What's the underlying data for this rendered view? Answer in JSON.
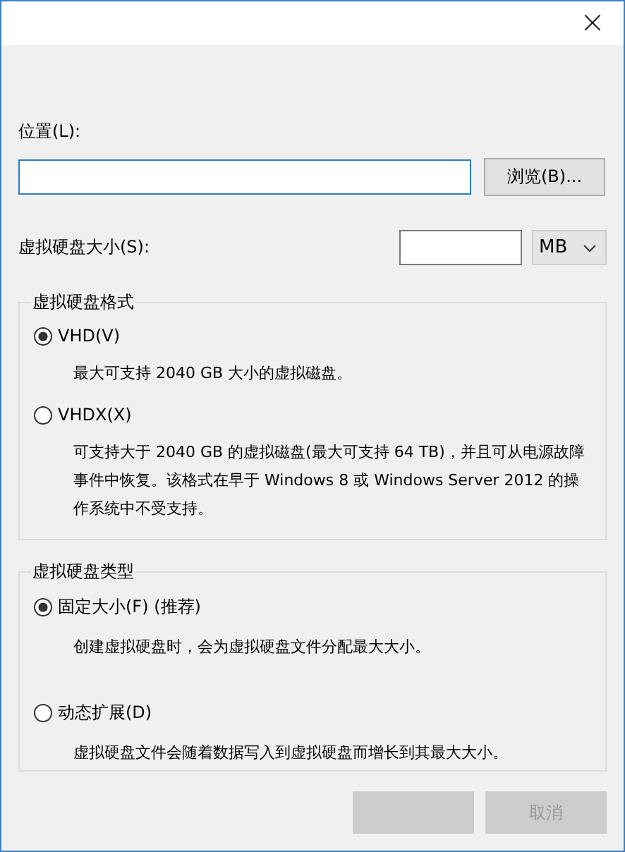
{
  "window": {
    "close": "×"
  },
  "location": {
    "label": "位置(L):",
    "browse": "浏览(B)..."
  },
  "size": {
    "label": "虚拟硬盘大小(S):",
    "unit": "MB"
  },
  "groups": [
    {
      "title": "虚拟硬盘格式",
      "options": [
        {
          "label": "VHD(V)",
          "selected": true,
          "description": "最大可支持 2040 GB 大小的虚拟磁盘。"
        },
        {
          "label": "VHDX(X)",
          "selected": false,
          "description": "可支持大于 2040 GB 的虚拟磁盘(最大可支持 64 TB)，并且可从电源故障事件中恢复。该格式在早于 Windows 8 或 Windows Server 2012 的操作系统中不受支持。"
        }
      ]
    },
    {
      "title": "虚拟硬盘类型",
      "options": [
        {
          "label": "固定大小(F) (推荐)",
          "selected": true,
          "description": "创建虚拟硬盘时，会为虚拟硬盘文件分配最大大小。"
        },
        {
          "label": "动态扩展(D)",
          "selected": false,
          "description": "虚拟硬盘文件会随着数据写入到虚拟硬盘而增长到其最大大小。"
        }
      ]
    }
  ],
  "buttons": [
    "取消"
  ]
}
